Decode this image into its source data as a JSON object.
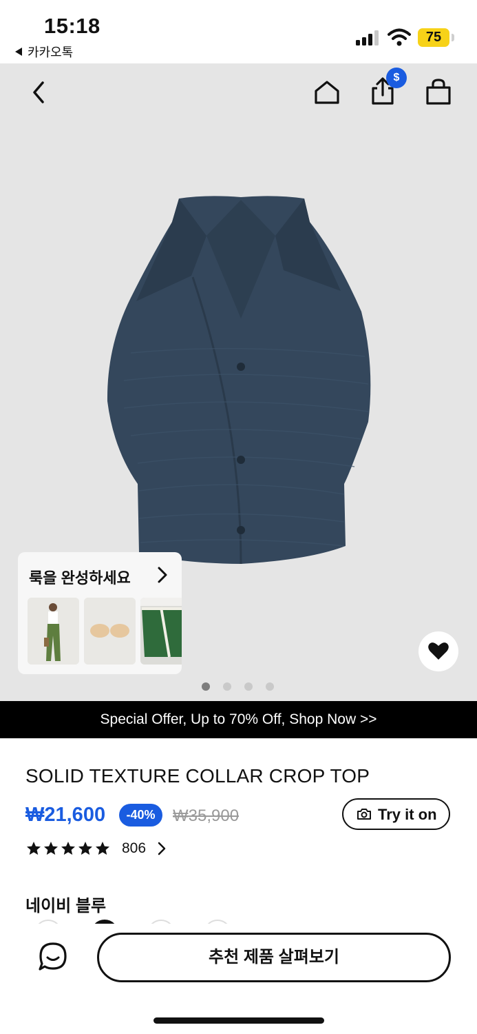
{
  "status_bar": {
    "time": "15:18",
    "back_app": "카카오톡",
    "battery": "75"
  },
  "header": {
    "cart_badge": "$",
    "icons": [
      "back-icon",
      "home-icon",
      "share-icon",
      "shopping-bag-icon"
    ]
  },
  "complete_look": {
    "title": "룩을 완성하세요"
  },
  "carousel": {
    "page_count": 4,
    "active_index": 0
  },
  "promo": {
    "text": "Special Offer, Up to 70% Off, Shop Now >>"
  },
  "product": {
    "title": "SOLID TEXTURE COLLAR CROP TOP",
    "price": "₩21,600",
    "discount": "-40%",
    "original_price": "₩35,900",
    "try_on_label": "Try it on",
    "rating": 5,
    "review_count": "806",
    "color_name": "네이비 블루"
  },
  "bottom_bar": {
    "cta_label": "추천 제품 살펴보기"
  },
  "colors": {
    "accent": "#1a5ce0",
    "hero_bg": "#e5e5e5",
    "product": "#34475c",
    "promo_bg": "#000000",
    "battery": "#f7d218"
  }
}
